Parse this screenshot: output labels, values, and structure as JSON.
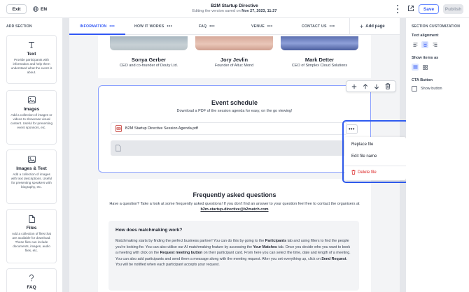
{
  "topbar": {
    "exit_label": "Exit",
    "language": "EN",
    "title": "B2M Startup Directive",
    "subtitle_prefix": "Editing the version saved on ",
    "subtitle_date": "Nov 27, 2023, 11:27",
    "save_label": "Save",
    "publish_label": "Publish"
  },
  "left_sidebar": {
    "heading": "ADD SECTION",
    "cards": [
      {
        "title": "Text",
        "description": "Provide participants with information and help them understand what the event is about.",
        "icon": "text-icon"
      },
      {
        "title": "Images",
        "description": "Add a collection of images or videos to showcase visual content. Useful for presenting event sponsors, etc.",
        "icon": "image-icon"
      },
      {
        "title": "Images & Text",
        "description": "Add a collection of images with text descriptions. Useful for presenting speakers with biography, etc.",
        "icon": "image-text-icon"
      },
      {
        "title": "Files",
        "description": "Add a collection of files that are available for download. These files can include documents, images, audio files, etc.",
        "icon": "file-icon"
      },
      {
        "title": "FAQ",
        "description": "",
        "icon": "question-icon"
      }
    ]
  },
  "tabs": [
    {
      "label": "INFORMATION"
    },
    {
      "label": "HOW IT WORKS"
    },
    {
      "label": "FAQ"
    },
    {
      "label": "VENUE"
    },
    {
      "label": "CONTACT US"
    }
  ],
  "add_page_label": "Add page",
  "speakers": [
    {
      "name": "Sonya Gerber",
      "role": "CEO and co-founder of Douty Ltd."
    },
    {
      "name": "Jory Jevlin",
      "role": "Founder of Altuc Mond"
    },
    {
      "name": "Mark Detter",
      "role": "CEO of Simplex Cloud Solutions"
    }
  ],
  "schedule": {
    "title": "Event schedule",
    "description": "Download a PDF of the session agenda for easy, on the go viewing!",
    "file_name": "B2M Startup Directive Session Agenda.pdf"
  },
  "context_menu": {
    "items": [
      "Replace file",
      "Edit file name"
    ],
    "danger_item": "Delete file"
  },
  "faq": {
    "title": "Frequently asked questions",
    "intro": "Have a question? Take a look at some frequently asked questions! If you don't find an answer to your question feel free to contact the organisers at",
    "email": "b2m-startup-directive@b2match.com",
    "question": "How does matchmaking work?",
    "answer_parts": [
      "Matchmaking starts by finding the perfect business partner! You can do this by going to the ",
      "Participants",
      " tab and using filters to find the people you're looking for. You can also utilise our AI matchmaking feature by accessing the ",
      "Your Matches",
      " tab. Once you decide who you want to book a meeting with click on the ",
      "Request meeting button",
      " on their participant card. From here you can select the time, date and length of a meeting. You can also add participants and send them a message along with the meeting request. After you set everything up, click on ",
      "Send Request",
      ". You will be notified when each participant accepts your request."
    ]
  },
  "right_sidebar": {
    "heading": "SECTION CUSTOMIZATION",
    "text_alignment_label": "Text alignment",
    "text_alignment_selected": "center",
    "show_items_label": "Show items as",
    "show_items_selected": "list",
    "cta_label": "CTA Button",
    "show_button_label": "Show button",
    "show_button_checked": false
  },
  "colors": {
    "accent": "#3157f5",
    "danger": "#dc2626",
    "outline": "#2f5bf0"
  }
}
